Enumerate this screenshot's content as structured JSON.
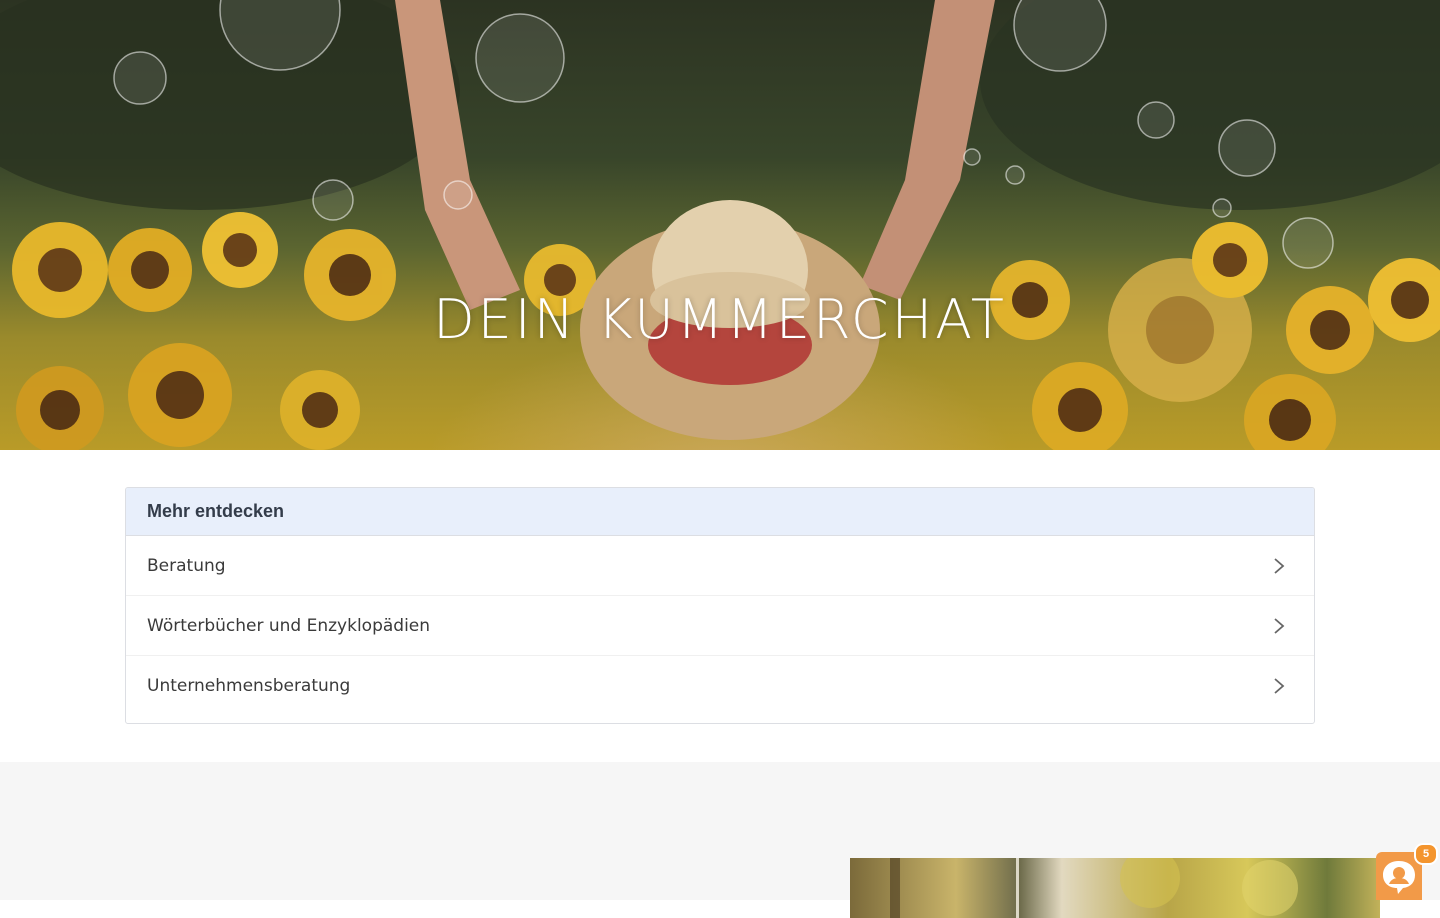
{
  "hero": {
    "title": "DEIN KUMMERCHAT"
  },
  "discover": {
    "heading": "Mehr entdecken",
    "items": [
      {
        "label": "Beratung"
      },
      {
        "label": "Wörterbücher und Enzyklopädien"
      },
      {
        "label": "Unternehmensberatung"
      }
    ]
  },
  "chat": {
    "badge_count": "5",
    "accent_color": "#f29a48"
  },
  "icons": {
    "item_chevron": "chevron-right-icon",
    "chat": "chat-bubble-icon"
  },
  "colors": {
    "panel_header_bg": "#e8effb",
    "section_gray_bg": "#f6f6f6"
  }
}
